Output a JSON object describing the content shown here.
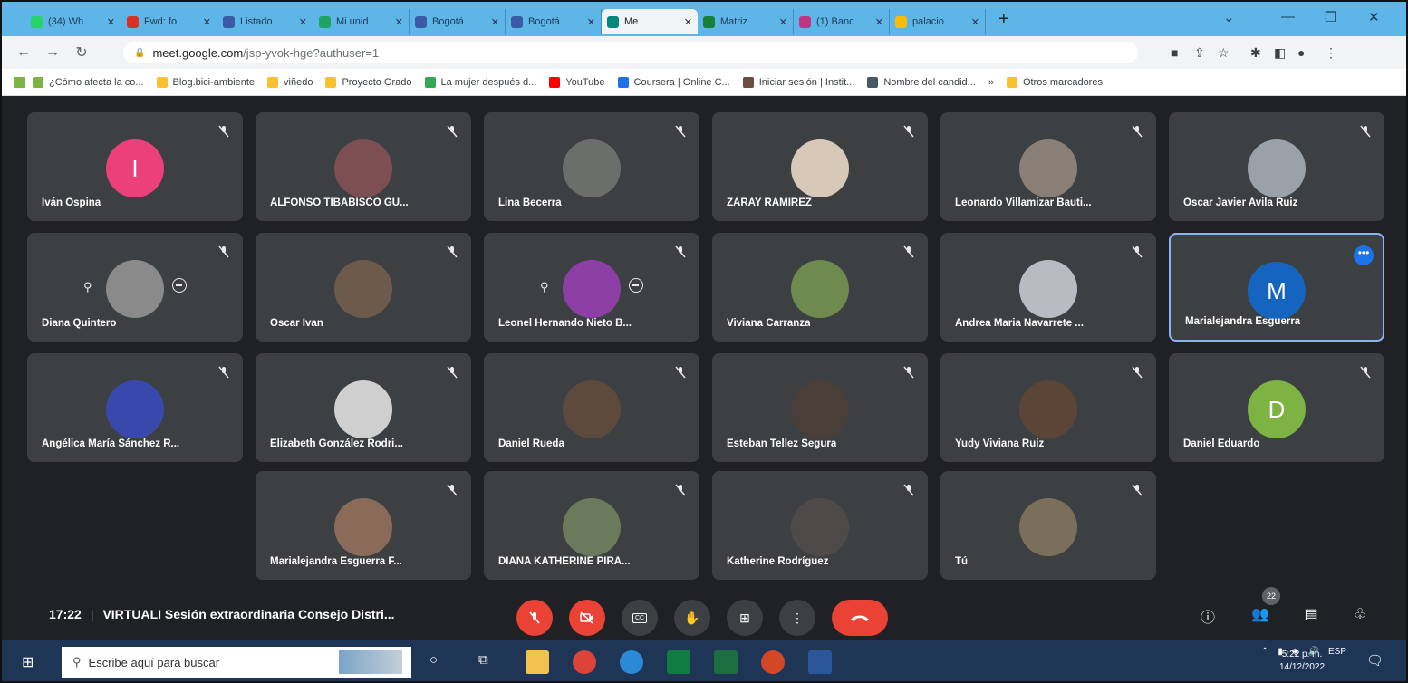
{
  "browser": {
    "tabs": [
      {
        "label": "(34) Wh",
        "color": "#25d366"
      },
      {
        "label": "Fwd: fo",
        "color": "#d93025"
      },
      {
        "label": "Listado",
        "color": "#3b5ba9"
      },
      {
        "label": "Mi unid",
        "color": "#1fa463"
      },
      {
        "label": "Bogotá",
        "color": "#3b5ba9"
      },
      {
        "label": "Bogotá",
        "color": "#3b5ba9"
      },
      {
        "label": "Me",
        "color": "#00897b",
        "active": true
      },
      {
        "label": "Matriz",
        "color": "#188038"
      },
      {
        "label": "(1) Banc",
        "color": "#c13584"
      },
      {
        "label": "palacio",
        "color": "#fbbc04"
      }
    ],
    "url_host": "meet.google.com",
    "url_path": "/jsp-yvok-hge?authuser=1",
    "bookmarks": [
      {
        "label": "¿Cómo afecta la co...",
        "color": "#7cb342"
      },
      {
        "label": "Blog.bici-ambiente",
        "color": "#fbc02d"
      },
      {
        "label": "viñedo",
        "color": "#fbc02d"
      },
      {
        "label": "Proyecto Grado",
        "color": "#fbc02d"
      },
      {
        "label": "La mujer después d...",
        "color": "#34a853"
      },
      {
        "label": "YouTube",
        "color": "#ff0000"
      },
      {
        "label": "Coursera | Online C...",
        "color": "#1a73e8"
      },
      {
        "label": "Iniciar sesión | Instit...",
        "color": "#6d4c41"
      },
      {
        "label": "Nombre del candid...",
        "color": "#455a64"
      },
      {
        "label": "»",
        "color": ""
      },
      {
        "label": "Otros marcadores",
        "color": "#fbc02d"
      }
    ]
  },
  "meet": {
    "participants": [
      {
        "name": "Iván Ospina",
        "avatar": "I",
        "color": "#ec407a"
      },
      {
        "name": "ALFONSO TIBABISCO GU...",
        "avatar": "",
        "color": "#7d4f53"
      },
      {
        "name": "Lina Becerra",
        "avatar": "",
        "color": "#6b6e6a"
      },
      {
        "name": "ZARAY RAMIREZ",
        "avatar": "",
        "color": "#d8c8b8"
      },
      {
        "name": "Leonardo Villamizar Bauti...",
        "avatar": "",
        "color": "#8a7f76"
      },
      {
        "name": "Oscar Javier Avila Ruiz",
        "avatar": "",
        "color": "#9aa1a8"
      },
      {
        "name": "Diana Quintero",
        "avatar": "",
        "color": "#8a8a8a",
        "pinned": true
      },
      {
        "name": "Oscar Ivan",
        "avatar": "",
        "color": "#6e5a4b"
      },
      {
        "name": "Leonel Hernando Nieto B...",
        "avatar": "",
        "color": "#8e3fa5",
        "pinned": true
      },
      {
        "name": "Viviana Carranza",
        "avatar": "",
        "color": "#6f8a4e"
      },
      {
        "name": "Andrea Maria Navarrete ...",
        "avatar": "",
        "color": "#b8bcc2"
      },
      {
        "name": "Marialejandra Esguerra",
        "avatar": "M",
        "color": "#1565c0",
        "selected": true
      },
      {
        "name": "Angélica María Sánchez R...",
        "avatar": "",
        "color": "#3949ab"
      },
      {
        "name": "Elizabeth González Rodri...",
        "avatar": "",
        "color": "#cfcfcf"
      },
      {
        "name": "Daniel Rueda",
        "avatar": "",
        "color": "#5d4a3c"
      },
      {
        "name": "Esteban Tellez Segura",
        "avatar": "",
        "color": "#4a3f38"
      },
      {
        "name": "Yudy Viviana Ruiz",
        "avatar": "",
        "color": "#5a4536"
      },
      {
        "name": "Daniel Eduardo",
        "avatar": "D",
        "color": "#7cb342"
      },
      {
        "name": "Marialejandra Esguerra F...",
        "avatar": "",
        "color": "#8a6a58"
      },
      {
        "name": "DIANA KATHERINE PIRA...",
        "avatar": "",
        "color": "#6a7a5a"
      },
      {
        "name": "Katherine Rodríguez",
        "avatar": "",
        "color": "#4e4a4a"
      },
      {
        "name": "Tú",
        "avatar": "",
        "color": "#7a6f5a"
      }
    ],
    "time": "17:22",
    "meeting_title": "VIRTUALI Sesión extraordinaria Consejo Distri...",
    "participant_count": "22"
  },
  "taskbar": {
    "search_placeholder": "Escribe aquí para buscar",
    "lang": "ESP",
    "clock_time": "5:22 p. m.",
    "clock_date": "14/12/2022"
  }
}
